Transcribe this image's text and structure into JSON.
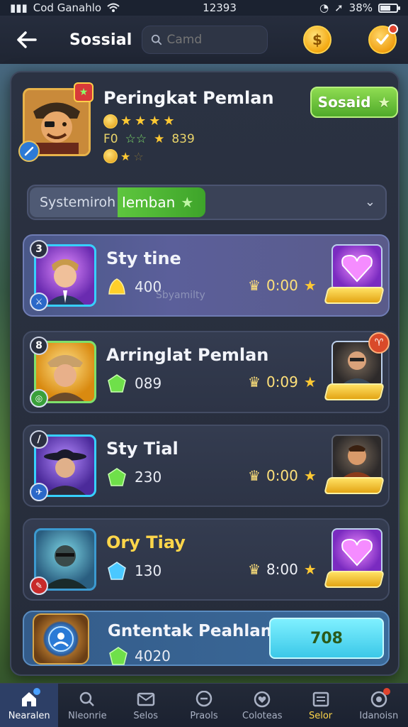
{
  "status_bar": {
    "carrier": "Cod Ganahlo",
    "time": "12393",
    "battery": "38%"
  },
  "top_bar": {
    "title": "Sossial",
    "search_placeholder": "Camd"
  },
  "profile": {
    "title": "Peringkat Pemlan",
    "stars": 4,
    "stats_prefix": "F0",
    "stats_value": "839",
    "social_button_label": "Sosaid"
  },
  "selector": {
    "left_label": "Systemiroh",
    "right_label": "Iemban"
  },
  "list_items": [
    {
      "title": "Sty tine",
      "score": "400",
      "sub": "Sbyamilty",
      "time": "0:00",
      "rank": "3",
      "reward": "purple"
    },
    {
      "title": "Arringlat Pemlan",
      "score": "089",
      "sub": "",
      "time": "0:09",
      "rank": "8",
      "reward": "dark"
    },
    {
      "title": "Sty Tial",
      "score": "230",
      "sub": "",
      "time": "0:00",
      "rank": "",
      "reward": "dark"
    },
    {
      "title": "Ory Tiay",
      "score": "130",
      "sub": "",
      "time": "8:00",
      "rank": "",
      "reward": "purple"
    }
  ],
  "bottom_item": {
    "title": "Gntentak Peahlan",
    "score": "4020",
    "value": "708"
  },
  "nav": [
    {
      "label": "Nearalen",
      "icon": "home-icon"
    },
    {
      "label": "Nleonrie",
      "icon": "search-icon"
    },
    {
      "label": "Selos",
      "icon": "mail-icon"
    },
    {
      "label": "Praols",
      "icon": "chat-icon"
    },
    {
      "label": "Coloteas",
      "icon": "heart-icon"
    },
    {
      "label": "Selor",
      "icon": "shop-icon"
    },
    {
      "label": "Idanoisn",
      "icon": "target-icon"
    }
  ],
  "colors": {
    "accent_green": "#5ec63e",
    "accent_gold": "#ffd64a",
    "panel": "#2b3242"
  }
}
